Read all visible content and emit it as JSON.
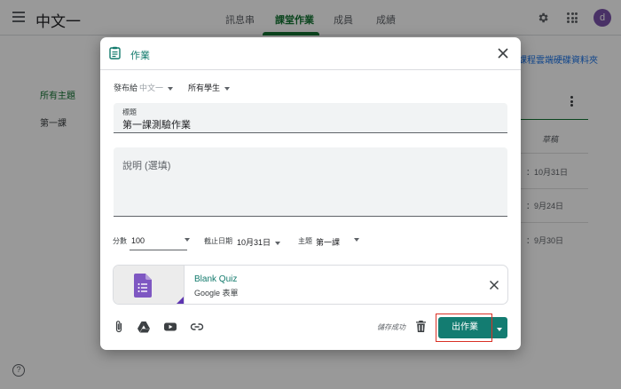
{
  "app": {
    "title": "中文一",
    "tabs": [
      {
        "label": "訊息串"
      },
      {
        "label": "課堂作業"
      },
      {
        "label": "成員"
      },
      {
        "label": "成績"
      }
    ],
    "avatar_letter": "d",
    "avatar_color": "#7b52ab"
  },
  "background": {
    "drive_folder": "課程雲端硬碟資料夾",
    "topics_all": "所有主題",
    "topic_lesson": "第一課",
    "draft_label": "草稿",
    "dates": [
      "：10月31日",
      "：9月24日",
      "：9月30日"
    ]
  },
  "dialog": {
    "title": "作業",
    "for_label": "發布給",
    "class_value": "中文一",
    "students_value": "所有學生",
    "title_field": {
      "label": "標題",
      "value": "第一課測驗作業"
    },
    "description_placeholder": "說明 (選填)",
    "points": {
      "label": "分數",
      "value": "100"
    },
    "due": {
      "label": "截止日期",
      "value": "10月31日"
    },
    "topic": {
      "label": "主題",
      "value": "第一課"
    },
    "attachment": {
      "title": "Blank Quiz",
      "subtitle": "Google 表單",
      "icon": "google-forms-icon"
    },
    "toolbar_icons": [
      "attach-icon",
      "google-drive-icon",
      "youtube-icon",
      "link-icon"
    ],
    "saved_status": "儲存成功",
    "assign_label": "出作業",
    "accent_color": "#137c71",
    "highlight_color": "#d93025"
  }
}
